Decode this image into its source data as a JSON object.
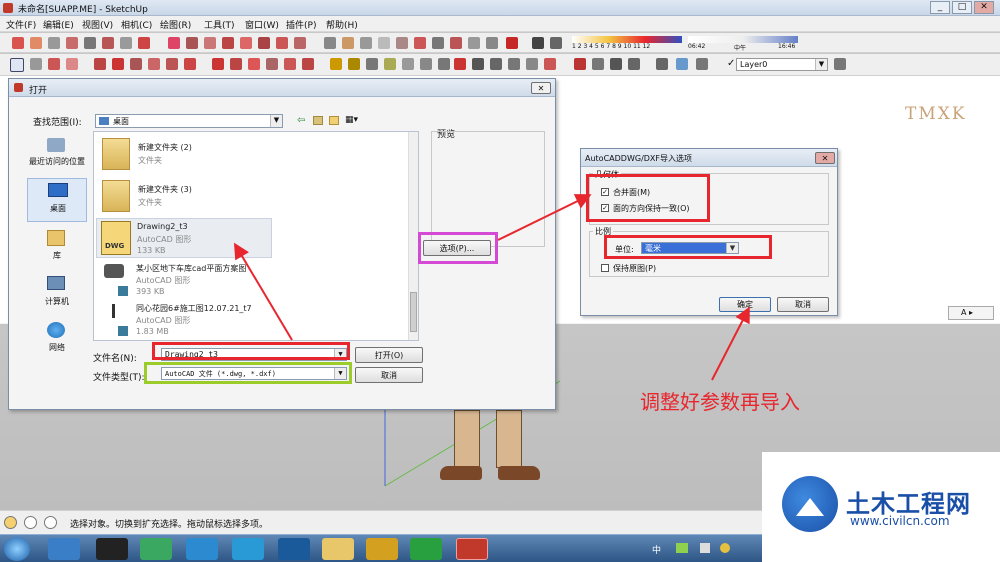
{
  "window": {
    "title": "未命名[SUAPP.ME] - SketchUp",
    "min": "_",
    "max": "□",
    "close": "✕"
  },
  "menu": [
    "文件(F)",
    "编辑(E)",
    "视图(V)",
    "相机(C)",
    "绘图(R)",
    "工具(T)",
    "窗口(W)",
    "插件(P)",
    "帮助(H)"
  ],
  "toolbar": {
    "shadow_months": "1 2 3 4 5 6 7 8 9 10 11 12",
    "time_start": "06:42",
    "time_mid": "中午",
    "time_end": "16:46",
    "layer": "Layer0"
  },
  "open_dialog": {
    "title": "打开",
    "look_in_label": "查找范围(I):",
    "look_in_value": "桌面",
    "preview_label": "预览",
    "places": [
      "最近访问的位置",
      "桌面",
      "库",
      "计算机",
      "网络"
    ],
    "files": [
      {
        "name": "新建文件夹 (2)",
        "type": "文件夹",
        "size": ""
      },
      {
        "name": "新建文件夹 (3)",
        "type": "文件夹",
        "size": ""
      },
      {
        "name": "Drawing2_t3",
        "type": "AutoCAD 图形",
        "size": "133 KB"
      },
      {
        "name": "某小区地下车库cad平面方案图",
        "type": "AutoCAD 图形",
        "size": "393 KB"
      },
      {
        "name": "同心花园6#施工图12.07.21_t7",
        "type": "AutoCAD 图形",
        "size": "1.83 MB"
      }
    ],
    "dwg_badge": "DWG",
    "filename_label": "文件名(N):",
    "filename_value": "Drawing2_t3",
    "filetype_label": "文件类型(T):",
    "filetype_value": "AutoCAD 文件 (*.dwg, *.dxf)",
    "open_button": "打开(O)",
    "cancel_button": "取消",
    "options_button": "选项(P)..."
  },
  "import_dialog": {
    "title": "AutoCADDWG/DXF导入选项",
    "geometry_group": "几何体",
    "merge_faces": "合并面(M)",
    "orient_faces": "面的方向保持一致(O)",
    "scale_group": "比例",
    "unit_label": "单位:",
    "unit_value": "毫米",
    "preserve_origin": "保持原图(P)",
    "ok_button": "确定",
    "cancel_button": "取消"
  },
  "annotation": "调整好参数再导入",
  "watermark_tmxk": "TMXK",
  "status_text": "选择对象。切换到扩充选择。拖动鼠标选择多项。",
  "side_label": "A",
  "logo": {
    "name": "土木工程网",
    "url": "www.civilcn.com"
  },
  "tray_text": "中",
  "colors": {
    "red_box": "#e8262e",
    "green_box": "#9ccc2a",
    "magenta_box": "#d44ad4",
    "accent": "#1a4fa8"
  }
}
